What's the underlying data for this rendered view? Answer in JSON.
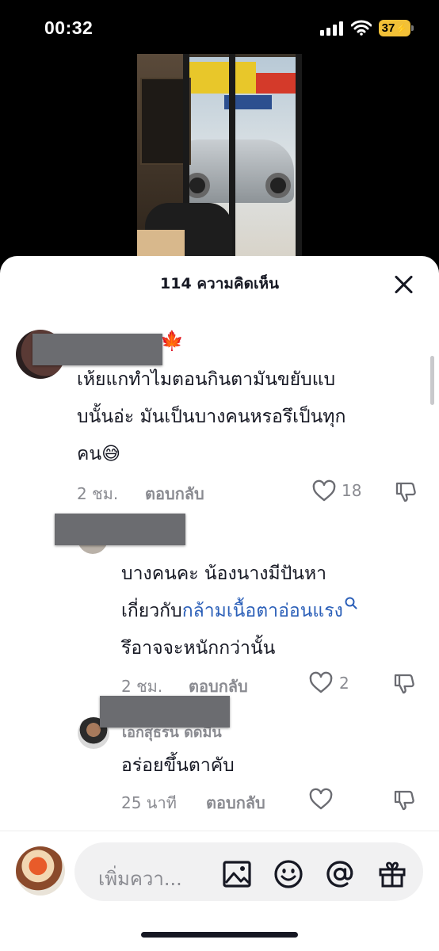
{
  "status_bar": {
    "time": "00:32",
    "battery": "37",
    "icons": [
      "signal-icon",
      "wifi-icon",
      "battery-charging-icon"
    ]
  },
  "comments_panel": {
    "title": "114 ความคิดเห็น",
    "close_icon": "close-icon"
  },
  "comments": [
    {
      "text_lines": [
        "เห้ยแกทำไมตอนกินตามันขยับแบ",
        "บนั้นอ่ะ มันเป็นบางคนหรอรึเป็นทุก",
        "คน😅"
      ],
      "time": "2 ชม.",
      "reply_label": "ตอบกลับ",
      "likes": "18"
    },
    {
      "text_line1": "บางคนคะ น้องนางมีปันหา",
      "text_line2_prefix": "เกี่ยวกับ",
      "text_line2_link": "กล้ามเนื้อตาอ่อนแรง",
      "text_line3": "รึอาจจะหนักกว่านั้น",
      "time": "2 ชม.",
      "reply_label": "ตอบกลับ",
      "likes": "2"
    },
    {
      "username": "เอกสุธรน ดดมืน",
      "text": "อร่อยขึ้นตาคับ",
      "time": "25 นาที",
      "reply_label": "ตอบกลับ"
    }
  ],
  "input_bar": {
    "placeholder": "เพิ่มควา...",
    "icons": [
      "image-icon",
      "emoji-icon",
      "mention-icon",
      "gift-icon"
    ]
  },
  "colors": {
    "link": "#2b5fb8",
    "secondary_text": "#8a8b91",
    "battery": "#f2c037"
  }
}
